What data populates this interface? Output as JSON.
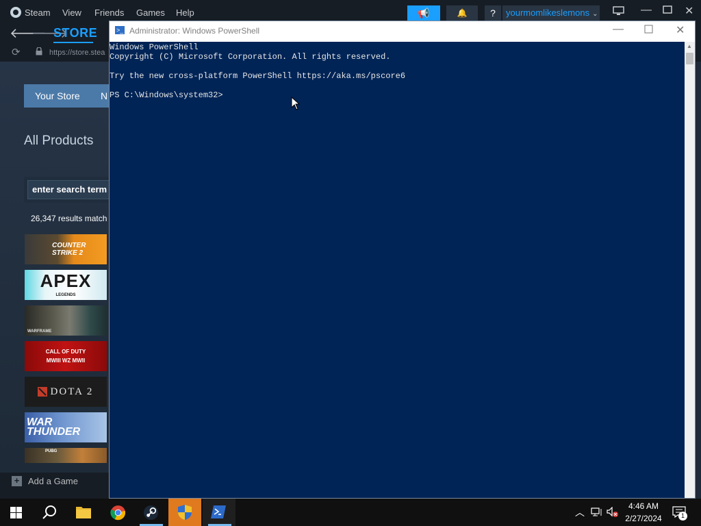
{
  "steam": {
    "menu": [
      "Steam",
      "View",
      "Friends",
      "Games",
      "Help"
    ],
    "username": "yourmomlikeslemons",
    "store_tab": "STORE",
    "url": "https://store.stea",
    "your_store_tab": "Your Store",
    "next_tab_fragment": "N",
    "section_title": "All Products",
    "search_placeholder": "enter search term o",
    "results_text": "26,347 results match",
    "add_game": "Add a Game",
    "games": [
      {
        "name": "COUNTER STRIKE 2"
      },
      {
        "name": "APEX",
        "sub": "LEGENDS"
      },
      {
        "name": "WARFRAME"
      },
      {
        "name": "CALL OF DUTY",
        "sub": "MWIII WZ MWII"
      },
      {
        "name": "DOTA 2"
      },
      {
        "name": "WAR THUNDER"
      },
      {
        "name": "PUBG"
      }
    ]
  },
  "powershell": {
    "title": "Administrator: Windows PowerShell",
    "lines": [
      "Windows PowerShell",
      "Copyright (C) Microsoft Corporation. All rights reserved.",
      "",
      "Try the new cross-platform PowerShell https://aka.ms/pscore6",
      "",
      "PS C:\\Windows\\system32>"
    ]
  },
  "taskbar": {
    "time": "4:46 AM",
    "date": "2/27/2024",
    "notification_count": "1"
  }
}
